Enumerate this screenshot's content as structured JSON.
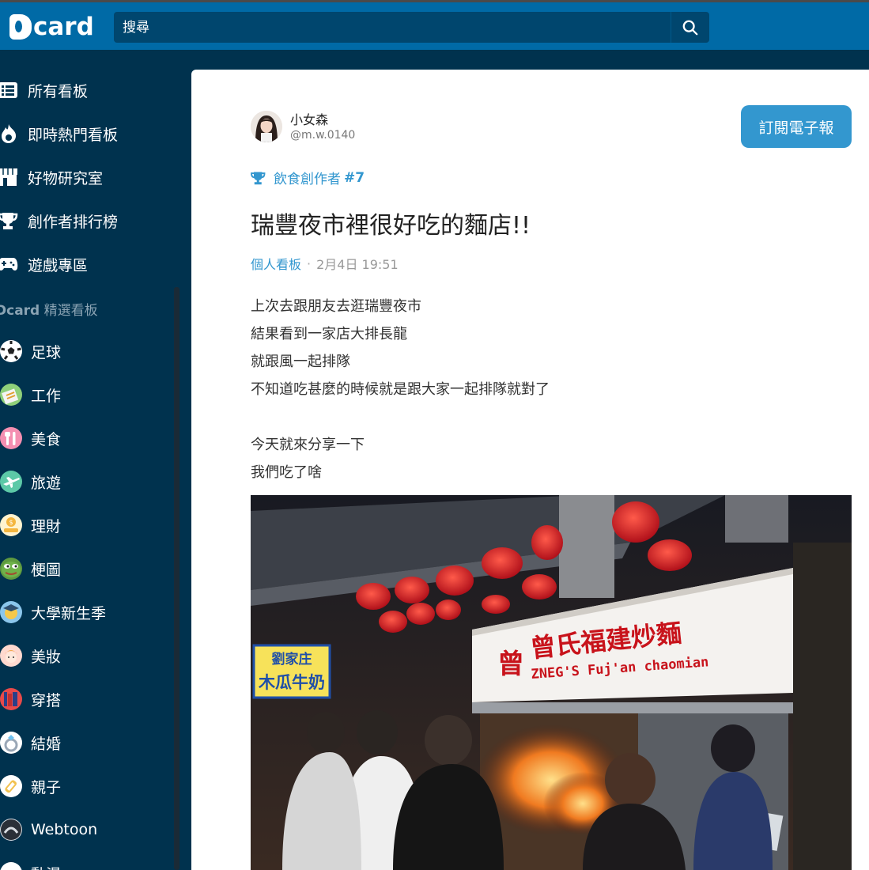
{
  "header": {
    "logo_text": "card",
    "search_placeholder": "搜尋"
  },
  "sidebar": {
    "items": [
      {
        "label": "所有看板",
        "icon": "list-icon"
      },
      {
        "label": "即時熱門看板",
        "icon": "flame-icon"
      },
      {
        "label": "好物研究室",
        "icon": "store-icon"
      },
      {
        "label": "創作者排行榜",
        "icon": "trophy-icon"
      },
      {
        "label": "遊戲專區",
        "icon": "gamepad-icon"
      }
    ],
    "section_brand": "Dcard",
    "section_label": "精選看板",
    "boards": [
      {
        "label": "足球",
        "icon": "soccer-ball-icon"
      },
      {
        "label": "工作",
        "icon": "work-icon"
      },
      {
        "label": "美食",
        "icon": "utensils-icon"
      },
      {
        "label": "旅遊",
        "icon": "airplane-icon"
      },
      {
        "label": "理財",
        "icon": "money-icon"
      },
      {
        "label": "梗圖",
        "icon": "frog-meme-icon"
      },
      {
        "label": "大學新生季",
        "icon": "campus-icon"
      },
      {
        "label": "美妝",
        "icon": "makeup-icon"
      },
      {
        "label": "穿搭",
        "icon": "outfit-icon"
      },
      {
        "label": "結婚",
        "icon": "ring-icon"
      },
      {
        "label": "親子",
        "icon": "baby-bottle-icon"
      },
      {
        "label": "Webtoon",
        "icon": "webtoon-icon"
      },
      {
        "label": "動漫",
        "icon": "anime-icon"
      }
    ]
  },
  "post": {
    "author_name": "小女森",
    "author_id": "@m.w.0140",
    "subscribe_label": "訂閱電子報",
    "rank_label": "飲食創作者",
    "rank_number": "#7",
    "title": "瑞豐夜市裡很好吃的麵店!!",
    "forum": "個人看板",
    "separator": "·",
    "timestamp": "2月4日 19:51",
    "body_lines": [
      "上次去跟朋友去逛瑞豐夜市",
      "結果看到一家店大排長龍",
      "就跟風一起排隊",
      "不知道吃甚麼的時候就是跟大家一起排隊就對了",
      "",
      "今天就來分享一下",
      "我們吃了啥"
    ],
    "photo_sign": {
      "main": "曾氏福建炒麵",
      "badge": "曾",
      "english": "ZNEG'S   Fuj'an chaomian",
      "side_sign_top": "劉家庄",
      "side_sign_main": "木瓜牛奶"
    }
  },
  "colors": {
    "header_bg": "#006aa6",
    "sidebar_bg": "#00324e",
    "accent": "#3397cf"
  }
}
